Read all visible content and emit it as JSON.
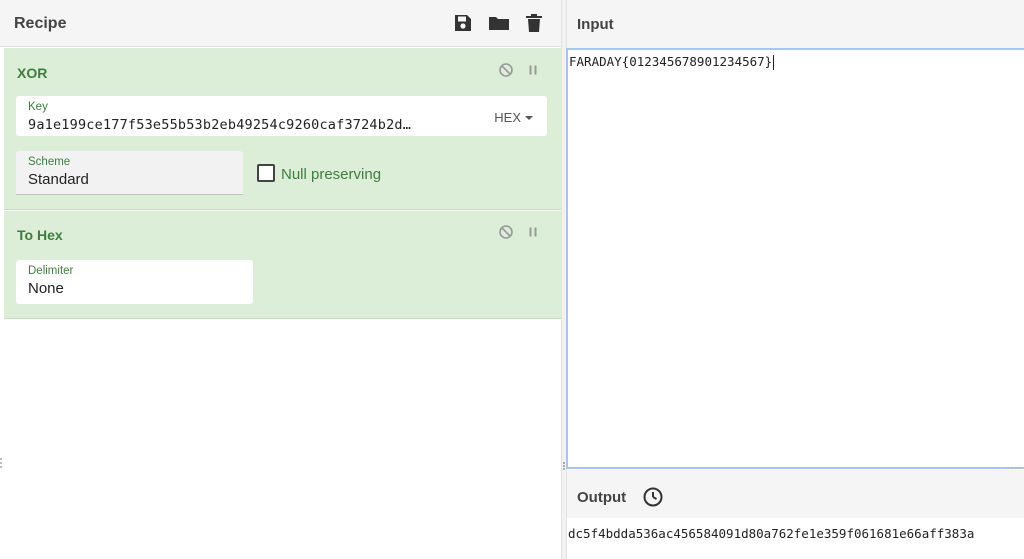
{
  "recipe": {
    "title": "Recipe",
    "icons": [
      "save-icon",
      "folder-icon",
      "trash-icon"
    ],
    "operations": [
      {
        "name": "XOR",
        "key_label": "Key",
        "key_value": "9a1e199ce177f53e55b53b2eb49254c9260caf3724b2d…",
        "key_format": "HEX",
        "scheme_label": "Scheme",
        "scheme_value": "Standard",
        "null_preserving_label": "Null preserving",
        "null_preserving_checked": false
      },
      {
        "name": "To Hex",
        "delimiter_label": "Delimiter",
        "delimiter_value": "None"
      }
    ]
  },
  "input": {
    "title": "Input",
    "text": "FARADAY{012345678901234567}"
  },
  "output": {
    "title": "Output",
    "text": "dc5f4bdda536ac456584091d80a762fe1e359f061681e66aff383a"
  },
  "colors": {
    "operation_bg": "#dcedd8",
    "operation_text": "#3f7d3f",
    "input_focus_border": "#a8c4f0"
  }
}
